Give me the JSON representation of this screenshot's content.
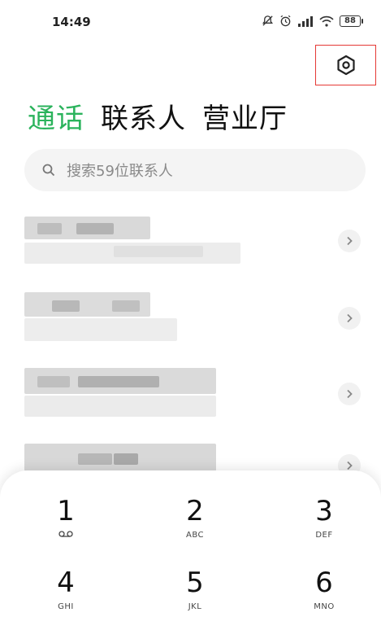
{
  "status_bar": {
    "time": "14:49",
    "battery": "88",
    "icons": [
      "mute-icon",
      "alarm-icon",
      "signal-icon",
      "wifi-icon",
      "battery-icon"
    ]
  },
  "header": {
    "settings_icon": "gear-hex-icon",
    "tabs": [
      {
        "label": "通话",
        "active": true
      },
      {
        "label": "联系人",
        "active": false
      },
      {
        "label": "营业厅",
        "active": false
      }
    ]
  },
  "search": {
    "placeholder": "搜索59位联系人"
  },
  "contacts_note": "pixelated-redacted-rows",
  "dialpad": {
    "keys": [
      {
        "digit": "1",
        "letters": "voicemail-icon"
      },
      {
        "digit": "2",
        "letters": "ABC"
      },
      {
        "digit": "3",
        "letters": "DEF"
      },
      {
        "digit": "4",
        "letters": "GHI"
      },
      {
        "digit": "5",
        "letters": "JKL"
      },
      {
        "digit": "6",
        "letters": "MNO"
      }
    ]
  },
  "colors": {
    "accent": "#2bb35c",
    "highlight_box": "#e53935"
  }
}
